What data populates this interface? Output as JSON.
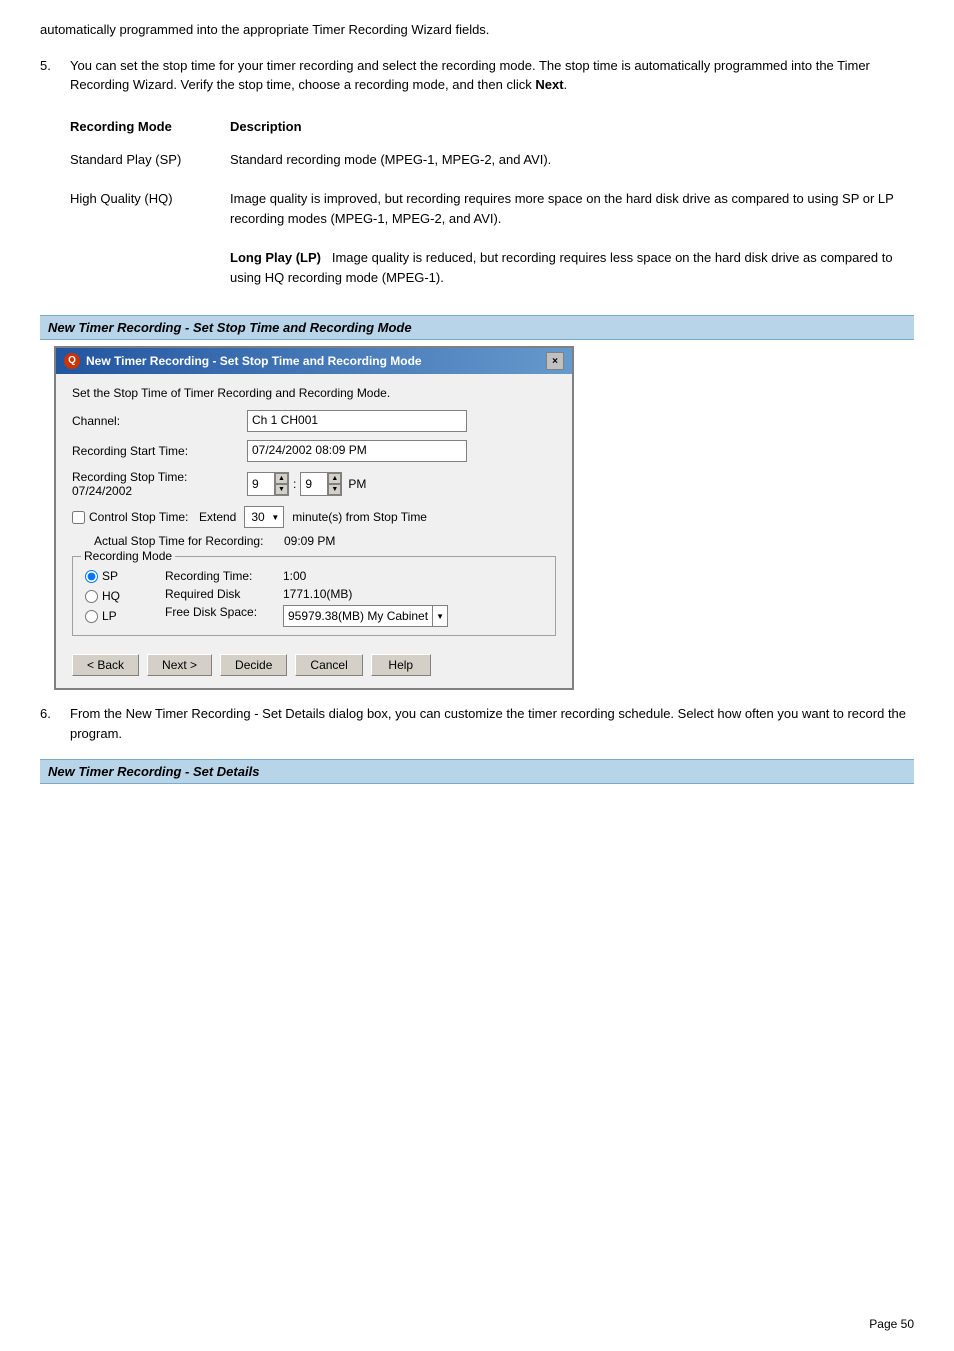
{
  "intro": {
    "text": "automatically programmed into the appropriate Timer Recording Wizard fields."
  },
  "step5": {
    "number": "5.",
    "text_before": "You can set the stop time for your timer recording and select the recording mode. The stop time is automatically programmed into the Timer Recording Wizard. Verify the stop time, choose a recording mode, and then click ",
    "bold_word": "Next",
    "text_after": "."
  },
  "table": {
    "col1": "Recording Mode",
    "col2": "Description",
    "rows": [
      {
        "mode": "Standard Play (SP)",
        "description": "Standard recording mode (MPEG-1, MPEG-2, and AVI)."
      },
      {
        "mode": "High Quality (HQ)",
        "description": "Image quality is improved, but recording requires more space on the hard disk drive as compared to using SP or LP recording modes (MPEG-1, MPEG-2, and AVI)."
      },
      {
        "mode": "Long Play (LP)",
        "description": "Image quality is reduced, but recording requires less space on the hard disk drive as compared to using HQ recording mode (MPEG-1)."
      }
    ]
  },
  "section_header1": {
    "text": "New Timer Recording - Set Stop Time and Recording Mode"
  },
  "dialog": {
    "title": "New Timer Recording - Set Stop Time and Recording Mode",
    "close_btn": "×",
    "icon_label": "Q",
    "description": "Set the Stop Time of Timer Recording and Recording Mode.",
    "channel_label": "Channel:",
    "channel_value": "Ch 1 CH001",
    "start_time_label": "Recording Start Time:",
    "start_time_value": "07/24/2002 08:09 PM",
    "stop_time_label": "Recording Stop Time: 07/24/2002",
    "stop_hour": "9",
    "stop_minute": "9",
    "stop_ampm": "PM",
    "control_stop_label": "Control Stop Time:",
    "extend_label": "Extend",
    "extend_value": "30",
    "minute_label": "minute(s) from Stop Time",
    "actual_stop_label": "Actual Stop Time for Recording:",
    "actual_stop_value": "09:09 PM",
    "recording_mode_legend": "Recording Mode",
    "radio_sp": "SP",
    "radio_hq": "HQ",
    "radio_lp": "LP",
    "recording_time_label": "Recording Time:",
    "recording_time_value": "1:00",
    "required_disk_label": "Required Disk",
    "required_disk_value": "1771.10(MB)",
    "free_disk_label": "Free Disk Space:",
    "free_disk_value": "95979.38(MB) My Cabinet",
    "btn_back": "< Back",
    "btn_next": "Next >",
    "btn_decide": "Decide",
    "btn_cancel": "Cancel",
    "btn_help": "Help"
  },
  "step6": {
    "number": "6.",
    "text": "From the New Timer Recording - Set Details dialog box, you can customize the timer recording schedule. Select how often you want to record the program."
  },
  "section_header2": {
    "text": "New Timer Recording - Set Details"
  },
  "page_number": "Page 50"
}
